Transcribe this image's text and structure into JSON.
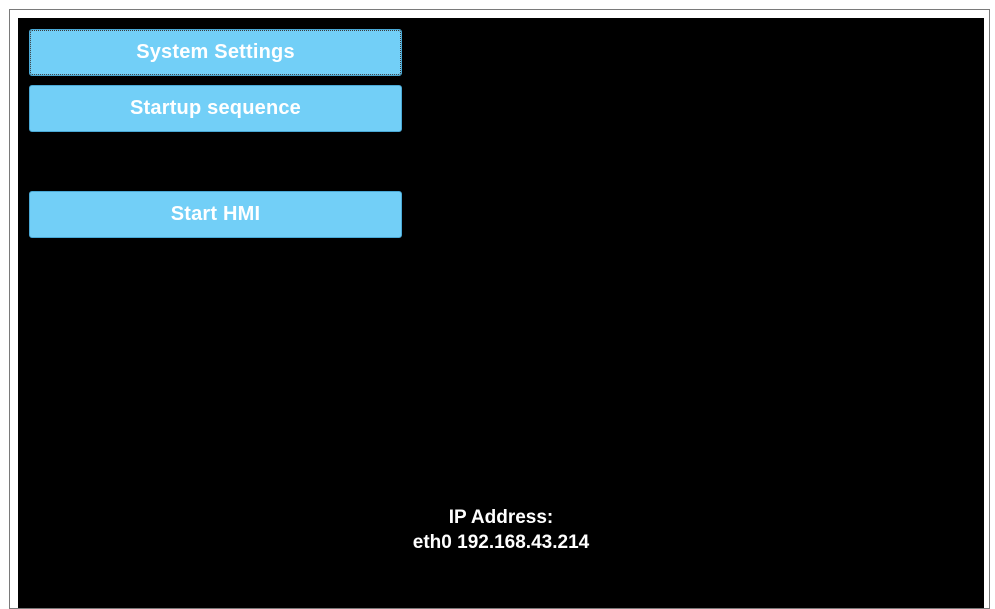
{
  "menu": {
    "system_settings_label": "System Settings",
    "startup_sequence_label": "Startup sequence",
    "start_hmi_label": "Start HMI"
  },
  "network": {
    "ip_label": "IP Address:",
    "ip_value": "eth0 192.168.43.214"
  },
  "colors": {
    "button_bg": "#72cff7",
    "screen_bg": "#000000",
    "text": "#ffffff"
  }
}
